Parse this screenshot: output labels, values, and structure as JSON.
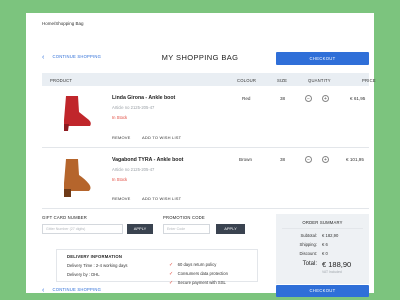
{
  "breadcrumb": "Home/Shopping Bag",
  "continue_label": "CONTINUE SHOPPING",
  "title": "MY SHOPPING BAG",
  "checkout_label": "CHECKOUT",
  "columns": {
    "product": "PRODUCT",
    "colour": "COLOUR",
    "size": "SIZE",
    "quantity": "QUANTITY",
    "price": "PRICE"
  },
  "items": [
    {
      "name": "Linda Girona - Ankle boot",
      "article": "Article no 2125-205-47",
      "stock": "In Stock",
      "colour": "Red",
      "size": "38",
      "price": "€ 61,95",
      "boot_color": "#c0262b",
      "boot_shade": "#8e1a1f"
    },
    {
      "name": "Vagabond TYRA - Ankle boot",
      "article": "Article no 2125-205-47",
      "stock": "In Stock",
      "colour": "Brown",
      "size": "38",
      "price": "€ 101,95",
      "boot_color": "#b5652c",
      "boot_shade": "#6e3a17"
    }
  ],
  "item_actions": {
    "remove": "REMOVE",
    "wishlist": "ADD TO WISH LIST"
  },
  "gift": {
    "label": "GIFT CARD NUMBER",
    "placeholder": "Gitter Number (27 digits)",
    "apply": "APPLY"
  },
  "promo": {
    "label": "PROMOTION CODE",
    "placeholder": "Enter Code",
    "apply": "APPLY"
  },
  "delivery": {
    "heading": "DELIVERY INFORMATION",
    "time": "Delivery Time : 2-4 working days",
    "by": "Delivery by : DHL",
    "benefits": [
      "60 days return policy",
      "Consumers data protection",
      "Secure payment with SSL"
    ]
  },
  "summary": {
    "heading": "ORDER SUMMARY",
    "rows": [
      {
        "label": "Subtotal:",
        "value": "€ 182,90"
      },
      {
        "label": "Shipping:",
        "value": "€ 6"
      },
      {
        "label": "Discount:",
        "value": "€ 0"
      }
    ],
    "total_label": "Total:",
    "total_value": "€ 188,90",
    "vat": "VAT Included"
  },
  "colors": {
    "accent": "#2f6fd8",
    "stock": "#e0453a",
    "background": "#7cc47e"
  }
}
